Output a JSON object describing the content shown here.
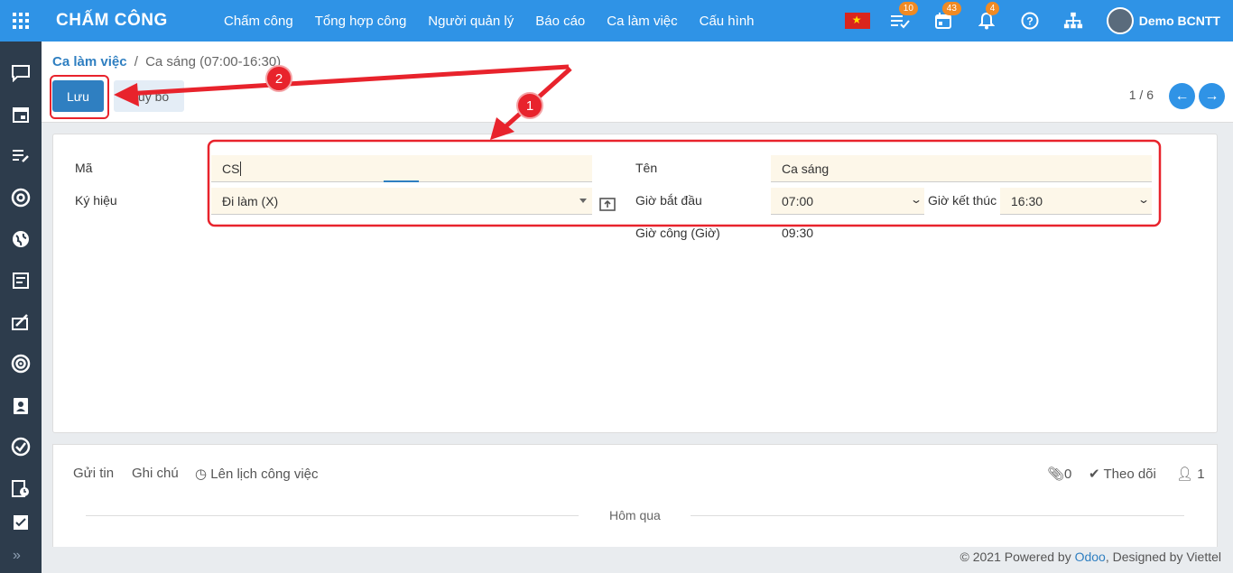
{
  "app": {
    "title": "CHẤM CÔNG"
  },
  "menu": [
    "Chấm công",
    "Tổng hợp công",
    "Người quản lý",
    "Báo cáo",
    "Ca làm việc",
    "Cấu hình"
  ],
  "systray": {
    "activity_count": "10",
    "calendar_count": "43",
    "notification_count": "4",
    "user_name": "Demo BCNTT"
  },
  "breadcrumb": {
    "parent": "Ca làm việc",
    "separator": "/",
    "current": "Ca sáng (07:00-16:30)"
  },
  "buttons": {
    "save": "Lưu",
    "discard": "Hủy bỏ"
  },
  "pager": {
    "value": "1 / 6"
  },
  "form": {
    "code_label": "Mã",
    "code_value": "CS",
    "symbol_label": "Ký hiệu",
    "symbol_value": "Đi làm (X)",
    "name_label": "Tên",
    "name_value": "Ca sáng",
    "start_label": "Giờ bắt đầu",
    "start_value": "07:00",
    "end_label": "Giờ kết thúc",
    "end_value": "16:30",
    "hours_label": "Giờ công (Giờ)",
    "hours_value": "09:30"
  },
  "chatter": {
    "send_message": "Gửi tin",
    "log_note": "Ghi chú",
    "schedule_activity": "Lên lịch công việc",
    "attachments": "0",
    "follow": "Theo dõi",
    "followers": "1",
    "date_separator": "Hôm qua"
  },
  "footer": {
    "prefix": "© 2021 Powered by",
    "odoo": "Odoo",
    "suffix": ", Designed by Viettel"
  },
  "annotations": {
    "step1": "1",
    "step2": "2"
  },
  "colors": {
    "primary": "#2f93e6",
    "sidebar": "#2d3c4c",
    "highlight": "#e8232c",
    "field_bg": "#fdf7e9"
  }
}
